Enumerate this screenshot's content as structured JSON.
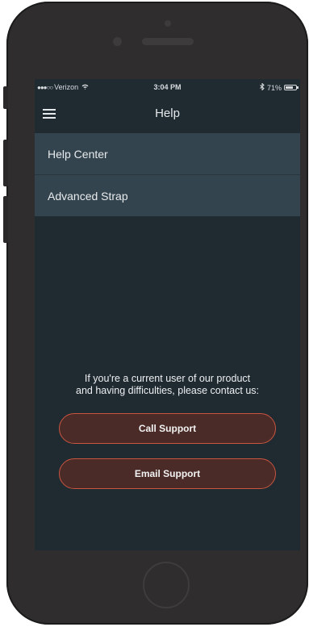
{
  "status_bar": {
    "carrier": "Verizon",
    "time": "3:04 PM",
    "battery": "71%",
    "battery_level": 0.71
  },
  "nav": {
    "title": "Help"
  },
  "menu": {
    "items": [
      {
        "label": "Help Center"
      },
      {
        "label": "Advanced Strap"
      }
    ]
  },
  "contact": {
    "line1": "If you're a current user of our product",
    "line2": "and having difficulties, please contact us:",
    "call_label": "Call Support",
    "email_label": "Email Support"
  },
  "colors": {
    "screen_bg": "#1f2a31",
    "row_bg": "#34444e",
    "button_border": "#c8553f",
    "button_bg": "#4a2b28"
  },
  "icons": [
    "signal-dots-icon",
    "wifi-icon",
    "bluetooth-icon",
    "battery-icon",
    "hamburger-menu-icon"
  ]
}
